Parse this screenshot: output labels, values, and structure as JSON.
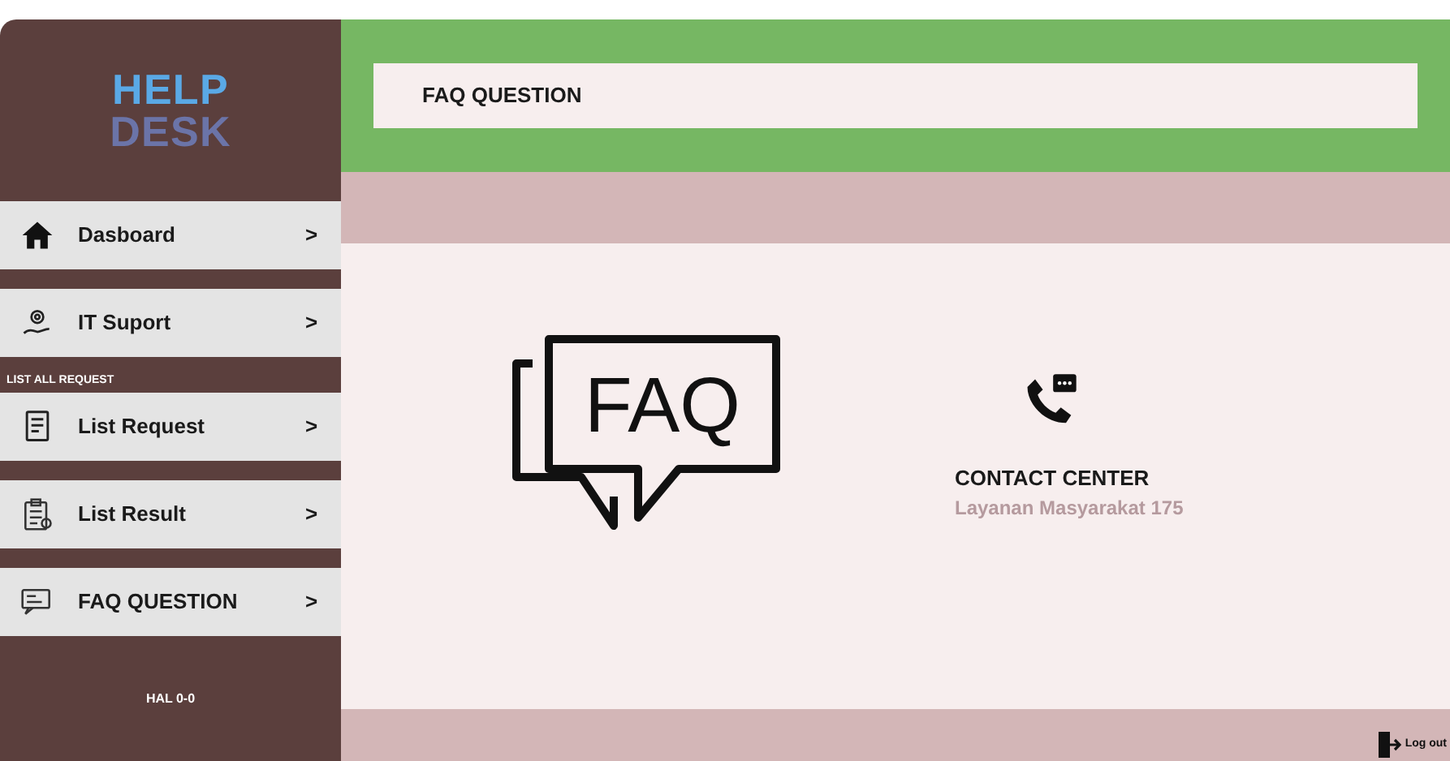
{
  "logo": {
    "line_1": "HELP",
    "line_2": "DESK"
  },
  "sidebar": {
    "items": [
      {
        "label": "Dasboard",
        "chevron": ">"
      },
      {
        "label": "IT Suport",
        "chevron": ">"
      },
      {
        "label": "List Request",
        "chevron": ">",
        "section": "LIST ALL REQUEST"
      },
      {
        "label": "List Result",
        "chevron": ">"
      },
      {
        "label": "FAQ QUESTION",
        "chevron": ">"
      }
    ],
    "footer": "HAL 0-0"
  },
  "header": {
    "title": "FAQ QUESTION"
  },
  "faq_graphic": {
    "label": "FAQ"
  },
  "contact": {
    "title": "CONTACT CENTER",
    "subtitle": "Layanan Masyarakat 175"
  },
  "footer": {
    "logout": "Log out"
  }
}
